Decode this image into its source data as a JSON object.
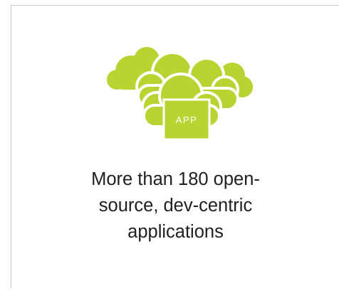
{
  "feature": {
    "icon_name": "cloud-apps-icon",
    "badge_label": "APP",
    "caption_lines": [
      "More than 180 open-",
      "source, dev-centric",
      "applications"
    ]
  },
  "colors": {
    "accent": "#B7D431",
    "border": "#C8C8C8",
    "text": "#1F1F1F"
  }
}
